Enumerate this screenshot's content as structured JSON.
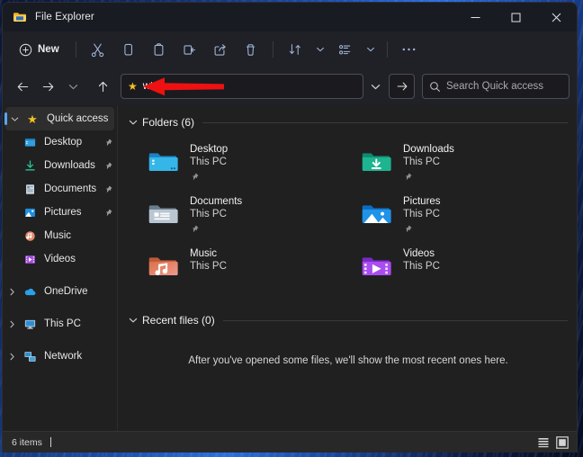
{
  "window": {
    "title": "File Explorer",
    "app_icon": "folder-icon",
    "controls": {
      "minimize": "minimize-icon",
      "maximize": "maximize-icon",
      "close": "close-icon"
    }
  },
  "toolbar": {
    "new_label": "New",
    "buttons": [
      {
        "name": "cut-button",
        "icon": "scissors-icon"
      },
      {
        "name": "copy-button",
        "icon": "copy-icon"
      },
      {
        "name": "paste-button",
        "icon": "clipboard-icon"
      },
      {
        "name": "rename-button",
        "icon": "rename-icon"
      },
      {
        "name": "share-button",
        "icon": "share-icon"
      },
      {
        "name": "delete-button",
        "icon": "trash-icon"
      }
    ],
    "sort_icon": "sort-icon",
    "view_icon": "view-icon",
    "more_icon": "ellipsis-icon"
  },
  "navbar": {
    "back_icon": "arrow-left-icon",
    "forward_icon": "arrow-right-icon",
    "recent_icon": "chevron-down-icon",
    "up_icon": "arrow-up-icon",
    "address_star_icon": "star-icon",
    "address_value": "wt",
    "address_chevron_icon": "chevron-down-icon",
    "go_icon": "arrow-right-icon",
    "search_icon": "search-icon",
    "search_placeholder": "Search Quick access"
  },
  "sidebar": {
    "items": [
      {
        "label": "Quick access",
        "icon": "star-icon",
        "expand": "chevron-down",
        "selected": true,
        "pinned": false,
        "indent": 0
      },
      {
        "label": "Desktop",
        "icon": "desktop-folder-icon",
        "expand": "none",
        "selected": false,
        "pinned": true,
        "indent": 1
      },
      {
        "label": "Downloads",
        "icon": "downloads-folder-icon",
        "expand": "none",
        "selected": false,
        "pinned": true,
        "indent": 1
      },
      {
        "label": "Documents",
        "icon": "documents-folder-icon",
        "expand": "none",
        "selected": false,
        "pinned": true,
        "indent": 1
      },
      {
        "label": "Pictures",
        "icon": "pictures-folder-icon",
        "expand": "none",
        "selected": false,
        "pinned": true,
        "indent": 1
      },
      {
        "label": "Music",
        "icon": "music-folder-icon",
        "expand": "none",
        "selected": false,
        "pinned": false,
        "indent": 1
      },
      {
        "label": "Videos",
        "icon": "videos-folder-icon",
        "expand": "none",
        "selected": false,
        "pinned": false,
        "indent": 1
      },
      {
        "label": "OneDrive",
        "icon": "onedrive-cloud-icon",
        "expand": "chevron-right",
        "selected": false,
        "pinned": false,
        "indent": 0,
        "gap_before": true
      },
      {
        "label": "This PC",
        "icon": "this-pc-icon",
        "expand": "chevron-right",
        "selected": false,
        "pinned": false,
        "indent": 0,
        "gap_before": true
      },
      {
        "label": "Network",
        "icon": "network-icon",
        "expand": "chevron-right",
        "selected": false,
        "pinned": false,
        "indent": 0,
        "gap_before": true
      }
    ]
  },
  "content": {
    "folders_header": "Folders (6)",
    "recent_header": "Recent files (0)",
    "recent_empty_text": "After you've opened some files, we'll show the most recent ones here.",
    "folders": [
      {
        "name": "Desktop",
        "location": "This PC",
        "icon": "desktop-folder-icon",
        "pinned": true
      },
      {
        "name": "Downloads",
        "location": "This PC",
        "icon": "downloads-folder-icon",
        "pinned": true
      },
      {
        "name": "Documents",
        "location": "This PC",
        "icon": "documents-folder-icon",
        "pinned": true
      },
      {
        "name": "Pictures",
        "location": "This PC",
        "icon": "pictures-folder-icon",
        "pinned": true
      },
      {
        "name": "Music",
        "location": "This PC",
        "icon": "music-folder-icon",
        "pinned": false
      },
      {
        "name": "Videos",
        "location": "This PC",
        "icon": "videos-folder-icon",
        "pinned": false
      }
    ]
  },
  "statusbar": {
    "item_count": "6 items",
    "list_view_icon": "details-view-icon",
    "tile_view_icon": "large-icons-view-icon"
  },
  "annotation": {
    "arrow_icon": "red-arrow-left",
    "color": "#ee1111"
  },
  "colors": {
    "accent": "#5aa3ef",
    "window_bg": "#202020",
    "titlebar_bg": "#191b22",
    "star": "#f3c220"
  }
}
